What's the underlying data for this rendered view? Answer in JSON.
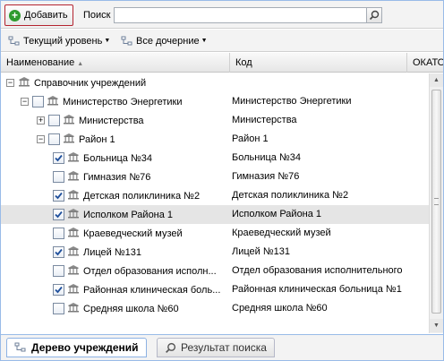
{
  "toolbar": {
    "add_label": "Добавить",
    "search_label": "Поиск",
    "search_value": ""
  },
  "toolbar2": {
    "level_label": "Текущий уровень",
    "children_label": "Все дочерние"
  },
  "columns": {
    "name": "Наименование",
    "code": "Код",
    "okato": "ОКАТО"
  },
  "tree": [
    {
      "name": "Справочник учреждений",
      "code": "",
      "level": 0,
      "toggle": "-",
      "checkbox": false,
      "checked": false,
      "selected": false
    },
    {
      "name": "Министерство Энергетики",
      "code": "Министерство Энергетики",
      "level": 1,
      "toggle": "-",
      "checkbox": true,
      "checked": false,
      "selected": false
    },
    {
      "name": "Министерства",
      "code": "Министерства",
      "level": 2,
      "toggle": "+",
      "checkbox": true,
      "checked": false,
      "selected": false
    },
    {
      "name": "Район 1",
      "code": "Район 1",
      "level": 2,
      "toggle": "-",
      "checkbox": true,
      "checked": false,
      "selected": false
    },
    {
      "name": "Больница №34",
      "code": "Больница №34",
      "level": 3,
      "toggle": "",
      "checkbox": true,
      "checked": true,
      "selected": false
    },
    {
      "name": "Гимназия №76",
      "code": "Гимназия №76",
      "level": 3,
      "toggle": "",
      "checkbox": true,
      "checked": false,
      "selected": false
    },
    {
      "name": "Детская поликлиника №2",
      "code": "Детская поликлиника №2",
      "level": 3,
      "toggle": "",
      "checkbox": true,
      "checked": true,
      "selected": false
    },
    {
      "name": "Исполком Района 1",
      "code": "Исполком Района 1",
      "level": 3,
      "toggle": "",
      "checkbox": true,
      "checked": true,
      "selected": true
    },
    {
      "name": "Краеведческий музей",
      "code": "Краеведческий музей",
      "level": 3,
      "toggle": "",
      "checkbox": true,
      "checked": false,
      "selected": false
    },
    {
      "name": "Лицей №131",
      "code": "Лицей №131",
      "level": 3,
      "toggle": "",
      "checkbox": true,
      "checked": true,
      "selected": false
    },
    {
      "name": "Отдел образования исполн...",
      "code": "Отдел образования исполнительного",
      "level": 3,
      "toggle": "",
      "checkbox": true,
      "checked": false,
      "selected": false
    },
    {
      "name": "Районная клиническая боль...",
      "code": "Районная клиническая больница №1",
      "level": 3,
      "toggle": "",
      "checkbox": true,
      "checked": true,
      "selected": false
    },
    {
      "name": "Средняя школа №60",
      "code": "Средняя школа №60",
      "level": 3,
      "toggle": "",
      "checkbox": true,
      "checked": false,
      "selected": false
    }
  ],
  "tabs": [
    {
      "label": "Дерево учреждений",
      "active": true,
      "icon": "tree-icon"
    },
    {
      "label": "Результат поиска",
      "active": false,
      "icon": "search-icon"
    }
  ],
  "colors": {
    "accent_border": "#b3232f",
    "selection": "#dfe8f6",
    "check_mark": "#1e4f9c"
  }
}
